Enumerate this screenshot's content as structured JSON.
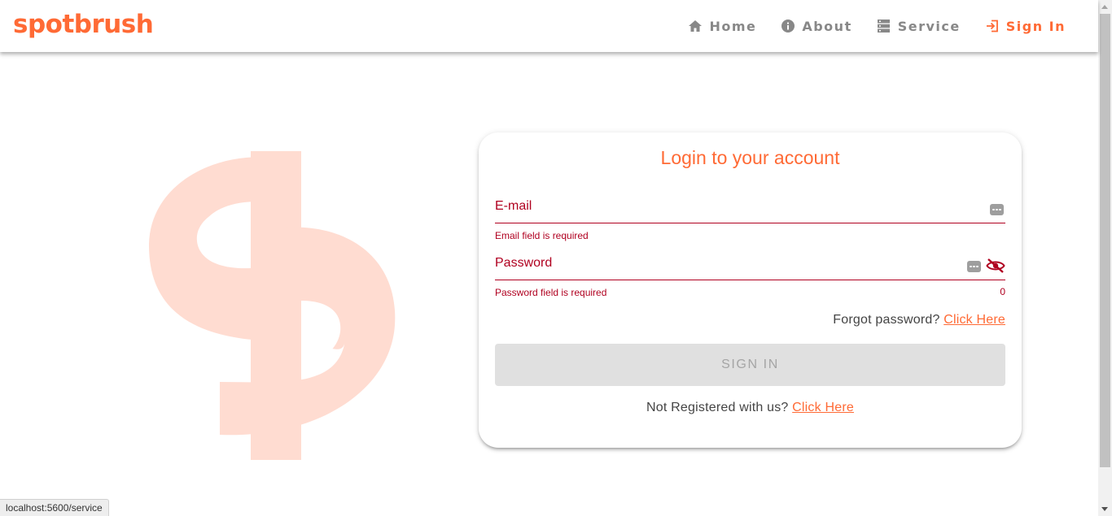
{
  "brand": "spotbrush",
  "nav": {
    "home": "Home",
    "about": "About",
    "service": "Service",
    "sign_in": "Sign In"
  },
  "login": {
    "title": "Login to your account",
    "email_label": "E-mail",
    "email_error": "Email field is required",
    "password_label": "Password",
    "password_error": "Password field is required",
    "password_counter": "0",
    "forgot_text": "Forgot password?",
    "forgot_link": "Click Here",
    "submit_label": "SIGN IN",
    "register_text": "Not Registered with us?",
    "register_link": "Click Here"
  },
  "status_url": "localhost:5600/service",
  "colors": {
    "brand": "#ff6a35",
    "error": "#b00020",
    "logo_art": "#ffdcd1"
  }
}
